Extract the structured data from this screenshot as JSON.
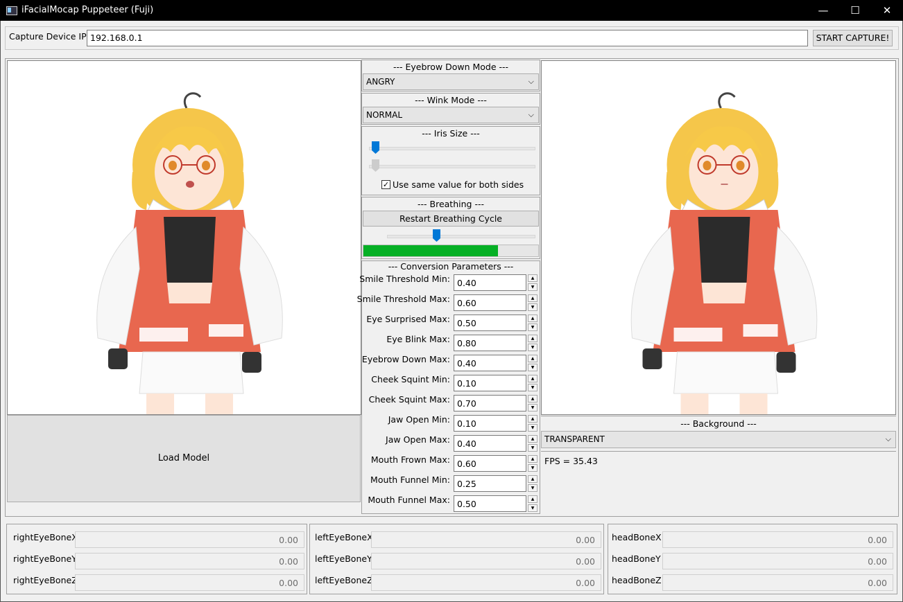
{
  "window": {
    "title": "iFacialMocap Puppeteer (Fuji)",
    "minimize": "—",
    "maximize": "☐",
    "close": "✕"
  },
  "capture": {
    "label": "Capture Device IP:",
    "ip": "192.168.0.1",
    "button": "START CAPTURE!"
  },
  "left": {
    "load_button": "Load Model"
  },
  "eyebrow": {
    "header": "--- Eyebrow Down Mode ---",
    "value": "ANGRY"
  },
  "wink": {
    "header": "--- Wink Mode ---",
    "value": "NORMAL"
  },
  "iris": {
    "header": "--- Iris Size ---",
    "checkbox_label": "Use same value for both sides",
    "checked": true,
    "slider1": 0.02,
    "slider2": 0.02
  },
  "breathing": {
    "header": "--- Breathing ---",
    "button": "Restart Breathing Cycle",
    "slider": 0.33,
    "progress": 0.77,
    "progress_color": "#06b025"
  },
  "conversion": {
    "header": "--- Conversion Parameters ---",
    "params": [
      {
        "label": "Smile Threshold Min:",
        "value": "0.40"
      },
      {
        "label": "Smile Threshold Max:",
        "value": "0.60"
      },
      {
        "label": "Eye Surprised Max:",
        "value": "0.50"
      },
      {
        "label": "Eye Blink Max:",
        "value": "0.80"
      },
      {
        "label": "Eyebrow Down Max:",
        "value": "0.40"
      },
      {
        "label": "Cheek Squint Min:",
        "value": "0.10"
      },
      {
        "label": "Cheek Squint Max:",
        "value": "0.70"
      },
      {
        "label": "Jaw Open Min:",
        "value": "0.10"
      },
      {
        "label": "Jaw Open Max:",
        "value": "0.40"
      },
      {
        "label": "Mouth Frown Max:",
        "value": "0.60"
      },
      {
        "label": "Mouth Funnel Min:",
        "value": "0.25"
      },
      {
        "label": "Mouth Funnel Max:",
        "value": "0.50"
      }
    ]
  },
  "background": {
    "header": "--- Background ---",
    "value": "TRANSPARENT"
  },
  "fps": "FPS = 35.43",
  "bones": {
    "right": [
      {
        "label": "rightEyeBoneX",
        "value": "0.00"
      },
      {
        "label": "rightEyeBoneY",
        "value": "0.00"
      },
      {
        "label": "rightEyeBoneZ",
        "value": "0.00"
      }
    ],
    "left": [
      {
        "label": "leftEyeBoneX",
        "value": "0.00"
      },
      {
        "label": "leftEyeBoneY",
        "value": "0.00"
      },
      {
        "label": "leftEyeBoneZ",
        "value": "0.00"
      }
    ],
    "head": [
      {
        "label": "headBoneX",
        "value": "0.00"
      },
      {
        "label": "headBoneY",
        "value": "0.00"
      },
      {
        "label": "headBoneZ",
        "value": "0.00"
      }
    ]
  },
  "colors": {
    "accent": "#0078d7",
    "hair": "#f7c948",
    "jacket": "#e8674f"
  }
}
